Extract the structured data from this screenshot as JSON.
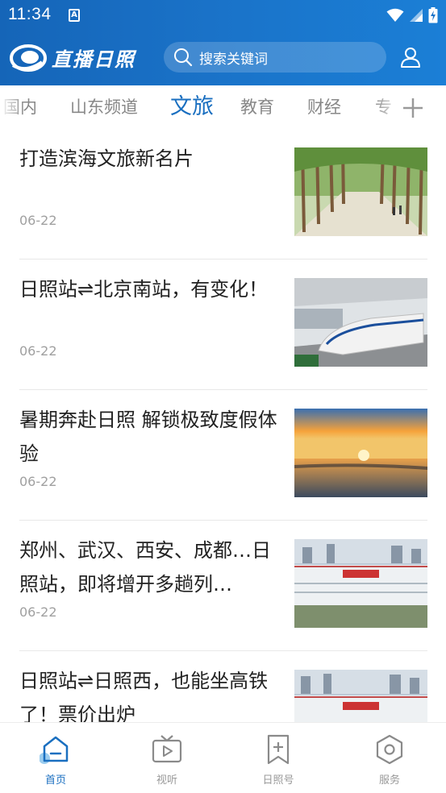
{
  "status_bar": {
    "time": "11:34",
    "notif_letter": "A"
  },
  "header": {
    "logo_text": "直播日照",
    "search_placeholder": "搜索关键词"
  },
  "tabs": [
    {
      "label": "国内",
      "active": false
    },
    {
      "label": "山东频道",
      "active": false
    },
    {
      "label": "文旅",
      "active": true
    },
    {
      "label": "教育",
      "active": false
    },
    {
      "label": "财经",
      "active": false
    },
    {
      "label": "专",
      "active": false
    }
  ],
  "news": [
    {
      "title": "打造滨海文旅新名片",
      "date": "06-22",
      "thumb": "forest-path"
    },
    {
      "title": "日照站⇌北京南站，有变化！",
      "date": "06-22",
      "thumb": "high-speed-train"
    },
    {
      "title": "暑期奔赴日照 解锁极致度假体验",
      "date": "06-22",
      "thumb": "sunset-sea"
    },
    {
      "title": "郑州、武汉、西安、成都…日照站，即将增开多趟列…",
      "date": "06-22",
      "thumb": "rizhao-station"
    },
    {
      "title": "日照站⇌日照西，也能坐高铁了！票价出炉",
      "date": "",
      "thumb": "rizhao-station-2"
    }
  ],
  "bottom_nav": [
    {
      "label": "首页",
      "icon": "home-icon",
      "active": true
    },
    {
      "label": "视听",
      "icon": "tv-icon",
      "active": false
    },
    {
      "label": "日照号",
      "icon": "bookmark-plus-icon",
      "active": false
    },
    {
      "label": "服务",
      "icon": "hexagon-icon",
      "active": false
    }
  ],
  "colors": {
    "brand": "#1a6fc0",
    "header_bg": "#1a73c9"
  }
}
